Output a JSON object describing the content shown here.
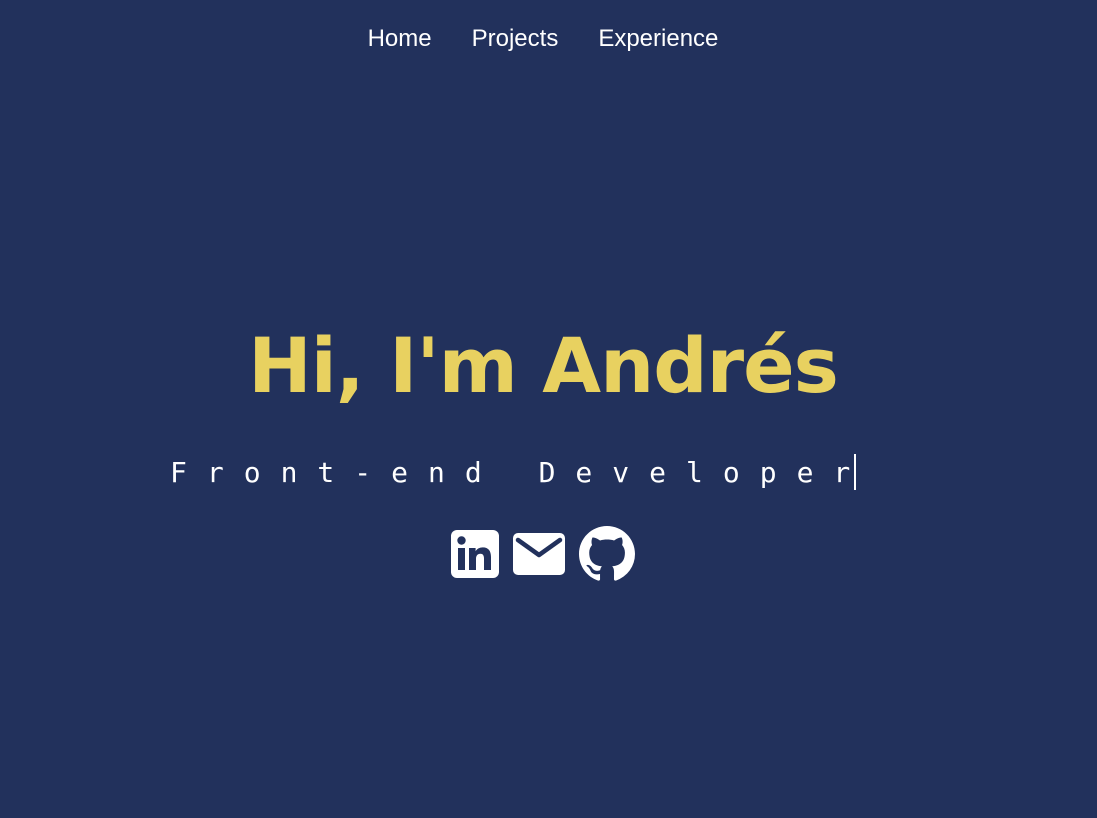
{
  "nav": {
    "items": [
      {
        "label": "Home"
      },
      {
        "label": "Projects"
      },
      {
        "label": "Experience"
      }
    ]
  },
  "hero": {
    "title": "Hi, I'm Andrés",
    "subtitle": "Front-end Developer"
  },
  "social": {
    "icons": [
      "linkedin-icon",
      "email-icon",
      "github-icon"
    ]
  },
  "colors": {
    "background": "#22315c",
    "accent": "#e8d160",
    "text": "#ffffff"
  }
}
